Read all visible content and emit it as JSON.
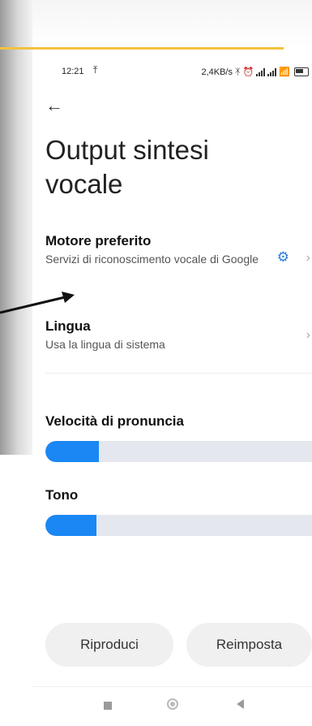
{
  "status_bar": {
    "time": "12:21",
    "upload_icon": "upload-arrow-icon",
    "network_speed": "2,4KB/s",
    "icons": [
      "bluetooth-icon",
      "alarm-icon",
      "signal-icon",
      "signal-icon",
      "wifi-icon",
      "battery-icon"
    ]
  },
  "header": {
    "back_icon": "back-arrow-icon",
    "title": "Output sintesi vocale"
  },
  "settings": {
    "engine": {
      "title": "Motore preferito",
      "subtitle": "Servizi di riconoscimento vocale di Google",
      "settings_icon": "gear-icon"
    },
    "language": {
      "title": "Lingua",
      "subtitle": "Usa la lingua di sistema"
    }
  },
  "sliders": {
    "speed": {
      "label": "Velocità di pronuncia",
      "value_fraction": 0.2
    },
    "pitch": {
      "label": "Tono",
      "value_fraction": 0.19
    }
  },
  "buttons": {
    "play": "Riproduci",
    "reset": "Reimposta"
  },
  "nav_bar": {
    "icons": [
      "recents-square-icon",
      "home-circle-icon",
      "back-triangle-icon"
    ]
  },
  "colors": {
    "accent": "#1a87f4",
    "settings_icon": "#2c7dd9",
    "highlight_line": "#f2c23e"
  }
}
